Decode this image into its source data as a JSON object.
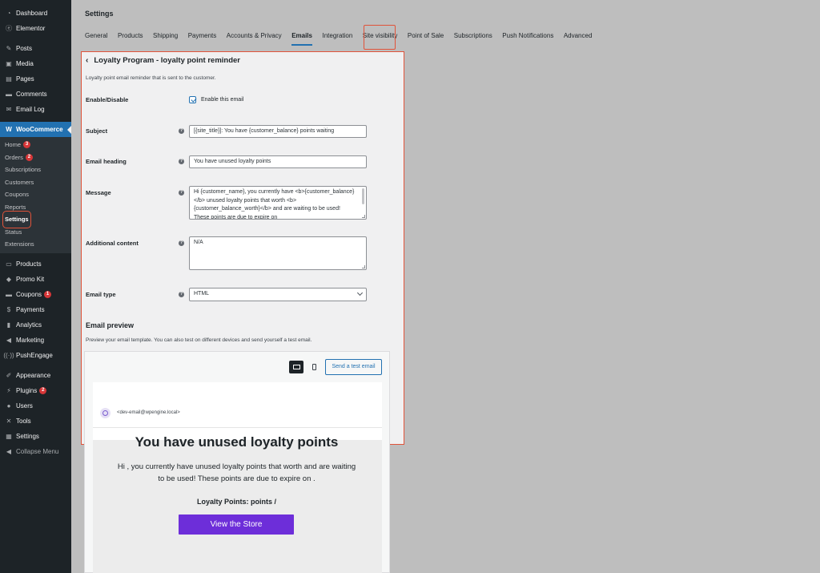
{
  "sidebar": {
    "items_top": [
      {
        "label": "Dashboard",
        "icon": "dashboard-icon",
        "glyph": "◔"
      },
      {
        "label": "Elementor",
        "icon": "elementor-icon",
        "glyph": "ⓔ"
      }
    ],
    "items_content": [
      {
        "label": "Posts",
        "icon": "pin-icon",
        "glyph": "✎"
      },
      {
        "label": "Media",
        "icon": "media-icon",
        "glyph": "▣"
      },
      {
        "label": "Pages",
        "icon": "pages-icon",
        "glyph": "▤"
      },
      {
        "label": "Comments",
        "icon": "comments-icon",
        "glyph": "▬"
      },
      {
        "label": "Email Log",
        "icon": "email-icon",
        "glyph": "✉"
      }
    ],
    "woocommerce": {
      "label": "WooCommerce",
      "icon": "woocommerce-icon",
      "glyph": "W"
    },
    "submenu": [
      {
        "label": "Home",
        "badge": "3"
      },
      {
        "label": "Orders",
        "badge": "2"
      },
      {
        "label": "Subscriptions",
        "badge": ""
      },
      {
        "label": "Customers",
        "badge": ""
      },
      {
        "label": "Coupons",
        "badge": ""
      },
      {
        "label": "Reports",
        "badge": ""
      },
      {
        "label": "Settings",
        "badge": ""
      },
      {
        "label": "Status",
        "badge": ""
      },
      {
        "label": "Extensions",
        "badge": ""
      }
    ],
    "items_shop": [
      {
        "label": "Products",
        "icon": "products-icon",
        "glyph": "▭",
        "badge": ""
      },
      {
        "label": "Promo Kit",
        "icon": "promo-kit-icon",
        "glyph": "◆",
        "badge": ""
      },
      {
        "label": "Coupons",
        "icon": "coupons-icon",
        "glyph": "▬",
        "badge": "1"
      },
      {
        "label": "Payments",
        "icon": "payments-icon",
        "glyph": "$",
        "badge": ""
      },
      {
        "label": "Analytics",
        "icon": "analytics-icon",
        "glyph": "▮",
        "badge": ""
      },
      {
        "label": "Marketing",
        "icon": "marketing-icon",
        "glyph": "◀",
        "badge": ""
      },
      {
        "label": "PushEngage",
        "icon": "pushengage-icon",
        "glyph": "((·))",
        "badge": ""
      }
    ],
    "items_admin": [
      {
        "label": "Appearance",
        "icon": "appearance-icon",
        "glyph": "✐",
        "badge": ""
      },
      {
        "label": "Plugins",
        "icon": "plugins-icon",
        "glyph": "⚡",
        "badge": "2"
      },
      {
        "label": "Users",
        "icon": "users-icon",
        "glyph": "●",
        "badge": ""
      },
      {
        "label": "Tools",
        "icon": "tools-icon",
        "glyph": "✕",
        "badge": ""
      },
      {
        "label": "Settings",
        "icon": "settings-icon",
        "glyph": "▦",
        "badge": ""
      }
    ],
    "collapse": {
      "label": "Collapse Menu",
      "glyph": "◀"
    }
  },
  "header": {
    "title": "Settings",
    "tabs": [
      "General",
      "Products",
      "Shipping",
      "Payments",
      "Accounts & Privacy",
      "Emails",
      "Integration",
      "Site visibility",
      "Point of Sale",
      "Subscriptions",
      "Push Notifications",
      "Advanced"
    ],
    "active_tab": "Emails"
  },
  "form": {
    "title": "Loyalty Program - loyalty point reminder",
    "description": "Loyalty point email reminder that is sent to the customer.",
    "enable_label": "Enable/Disable",
    "enable_checkbox_label": "Enable this email",
    "enabled": true,
    "subject_label": "Subject",
    "subject_value": "[{site_title}]: You have {customer_balance} points waiting",
    "heading_label": "Email heading",
    "heading_value": "You have unused loyalty points",
    "message_label": "Message",
    "message_value": "Hi {customer_name}, you currently have <b>{customer_balance}</b> unused loyalty points that worth <b>{customer_balance_worth}</b> and are waiting to be used! These points are due to expire on",
    "additional_label": "Additional content",
    "additional_value": "N/A",
    "email_type_label": "Email type",
    "email_type_value": "HTML",
    "help_glyph": "?"
  },
  "preview": {
    "heading": "Email preview",
    "description": "Preview your email template. You can also test on different devices and send yourself a test email.",
    "test_button": "Send a test email",
    "from": "<dev-email@wpengine.local>",
    "email_title": "You have unused loyalty points",
    "email_text": "Hi , you currently have unused loyalty points that worth and are waiting to be used! These points are due to expire on .",
    "email_points": "Loyalty Points: points /",
    "cta_label": "View the Store"
  },
  "colors": {
    "accent": "#2271b1",
    "highlight": "#e0533a",
    "cta": "#6d2ed9",
    "sidebar": "#1d2327"
  }
}
